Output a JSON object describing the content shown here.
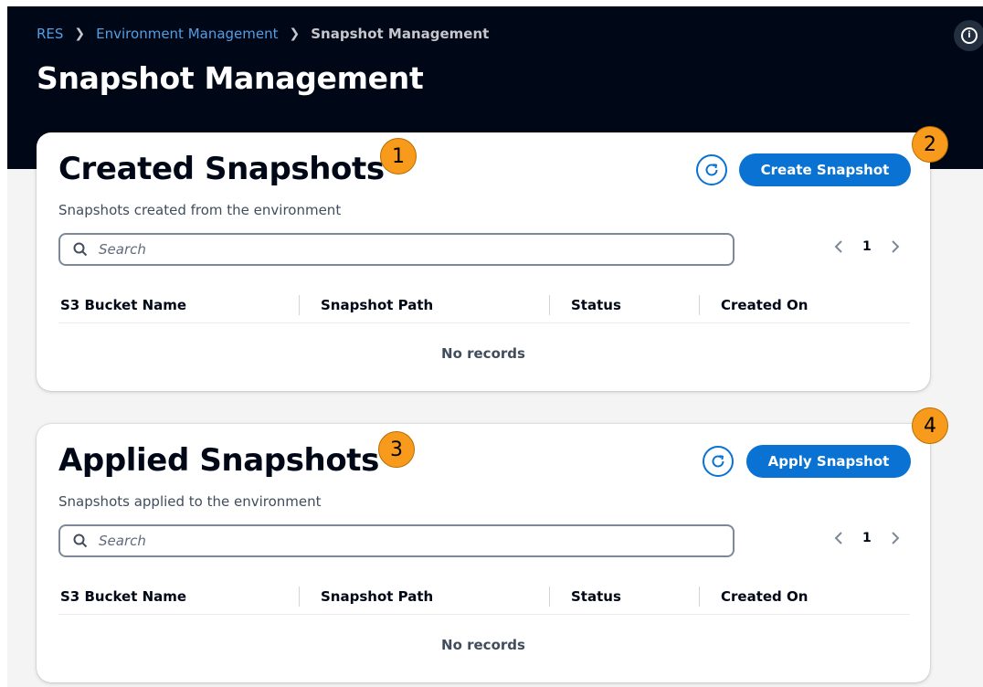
{
  "breadcrumb": {
    "items": [
      "RES",
      "Environment Management"
    ],
    "current": "Snapshot Management"
  },
  "page": {
    "title": "Snapshot Management"
  },
  "created": {
    "title": "Created Snapshots",
    "description": "Snapshots created from the environment",
    "button_label": "Create Snapshot",
    "search_placeholder": "Search",
    "page_number": "1",
    "columns": [
      "S3 Bucket Name",
      "Snapshot Path",
      "Status",
      "Created On"
    ],
    "empty_text": "No records"
  },
  "applied": {
    "title": "Applied Snapshots",
    "description": "Snapshots applied to the environment",
    "button_label": "Apply Snapshot",
    "search_placeholder": "Search",
    "page_number": "1",
    "columns": [
      "S3 Bucket Name",
      "Snapshot Path",
      "Status",
      "Created On"
    ],
    "empty_text": "No records"
  },
  "markers": [
    "1",
    "2",
    "3",
    "4"
  ],
  "colors": {
    "header_bg": "#000716",
    "primary": "#0972d3",
    "marker": "#f89b1c"
  }
}
